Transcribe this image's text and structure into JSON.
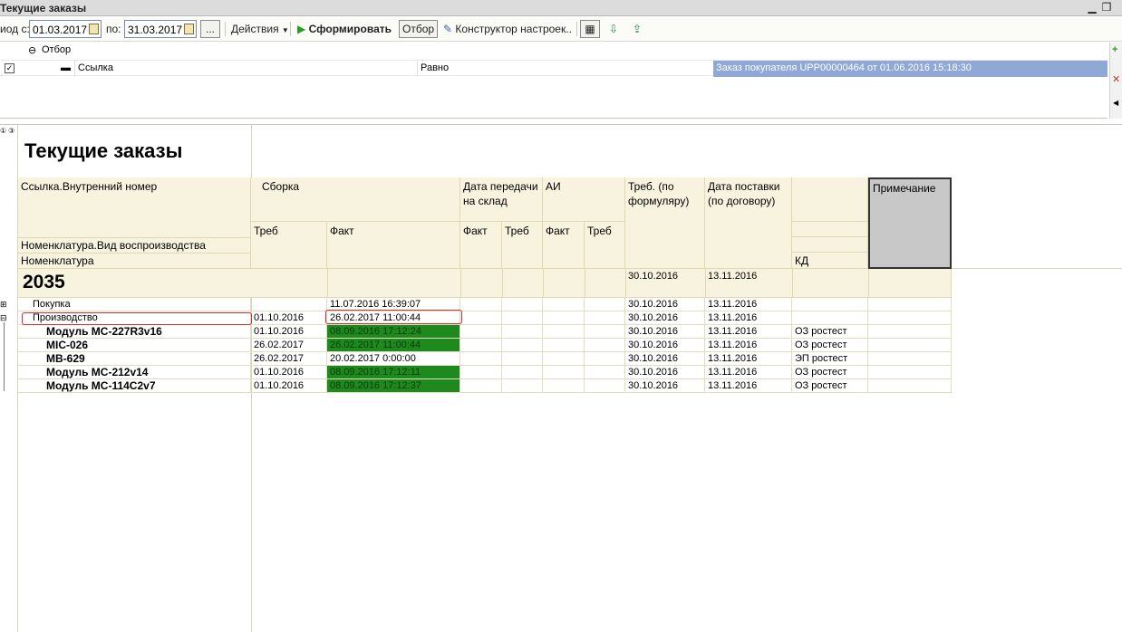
{
  "window": {
    "title": "Текущие заказы",
    "minimize_icon": "minimize-icon",
    "restore_icon": "restore-icon"
  },
  "toolbar": {
    "period_from_label": "иод с:",
    "period_from_value": "01.03.2017",
    "period_to_label": "по:",
    "period_to_value": "31.03.2017",
    "ellipsis_label": "...",
    "actions_label": "Действия",
    "generate_label": "Сформировать",
    "filter_label": "Отбор",
    "settings_label": "Конструктор настроек..."
  },
  "filter": {
    "group_label": "Отбор",
    "row": {
      "field": "Ссылка",
      "condition": "Равно",
      "value": "Заказ покупателя UPP00000464 от 01.06.2016 15:18:30"
    }
  },
  "report": {
    "title": "Текущие заказы",
    "headers": {
      "ref_number": "Ссылка.Внутренний номер",
      "nomenclature_type": "Номенклатура.Вид воспроизводства",
      "nomenclature": "Номенклатура",
      "assembly": "Сборка",
      "assembly_req": "Треб",
      "assembly_fact": "Факт",
      "transfer_date": "Дата передачи на склад",
      "transfer_fact": "Факт",
      "transfer_req": "Треб",
      "ai": "АИ",
      "ai_fact": "Факт",
      "ai_req": "Треб",
      "req_form": "Треб. (по формуляру)",
      "delivery_date": "Дата поставки (по договору)",
      "kd": "КД",
      "note": "Примечание"
    },
    "group": {
      "number": "2035",
      "req_form": "30.10.2016",
      "delivery": "13.11.2016"
    },
    "rows": [
      {
        "name": "Покупка",
        "req": "",
        "fact": "11.07.2016 16:39:07",
        "req_form": "30.10.2016",
        "delivery": "13.11.2016",
        "kd": "",
        "green": false
      },
      {
        "name": "Производство",
        "req": "01.10.2016",
        "fact": "26.02.2017 11:00:44",
        "req_form": "30.10.2016",
        "delivery": "13.11.2016",
        "kd": "",
        "green": false
      },
      {
        "name": "Модуль МС-227R3v16",
        "req": "01.10.2016",
        "fact": "08.09.2016 17:12:24",
        "req_form": "30.10.2016",
        "delivery": "13.11.2016",
        "kd": "ОЗ ростест",
        "green": true
      },
      {
        "name": "MIC-026",
        "req": "26.02.2017",
        "fact": "26.02.2017 11:00:44",
        "req_form": "30.10.2016",
        "delivery": "13.11.2016",
        "kd": "ОЗ ростест",
        "green": true
      },
      {
        "name": "МВ-629",
        "req": "26.02.2017",
        "fact": "20.02.2017 0:00:00",
        "req_form": "30.10.2016",
        "delivery": "13.11.2016",
        "kd": "ЭП ростест",
        "green": false
      },
      {
        "name": "Модуль МС-212v14",
        "req": "01.10.2016",
        "fact": "08.09.2016 17:12:11",
        "req_form": "30.10.2016",
        "delivery": "13.11.2016",
        "kd": "ОЗ ростест",
        "green": true
      },
      {
        "name": "Модуль МС-114С2v7",
        "req": "01.10.2016",
        "fact": "08.09.2016 17:12:37",
        "req_form": "30.10.2016",
        "delivery": "13.11.2016",
        "kd": "ОЗ ростест",
        "green": true
      }
    ],
    "colors": {
      "header_bg": "#f7f3de",
      "fact_green": "#1e8a1e",
      "selected_bg": "#8fa8d8",
      "annotation_red": "#d03030"
    }
  }
}
